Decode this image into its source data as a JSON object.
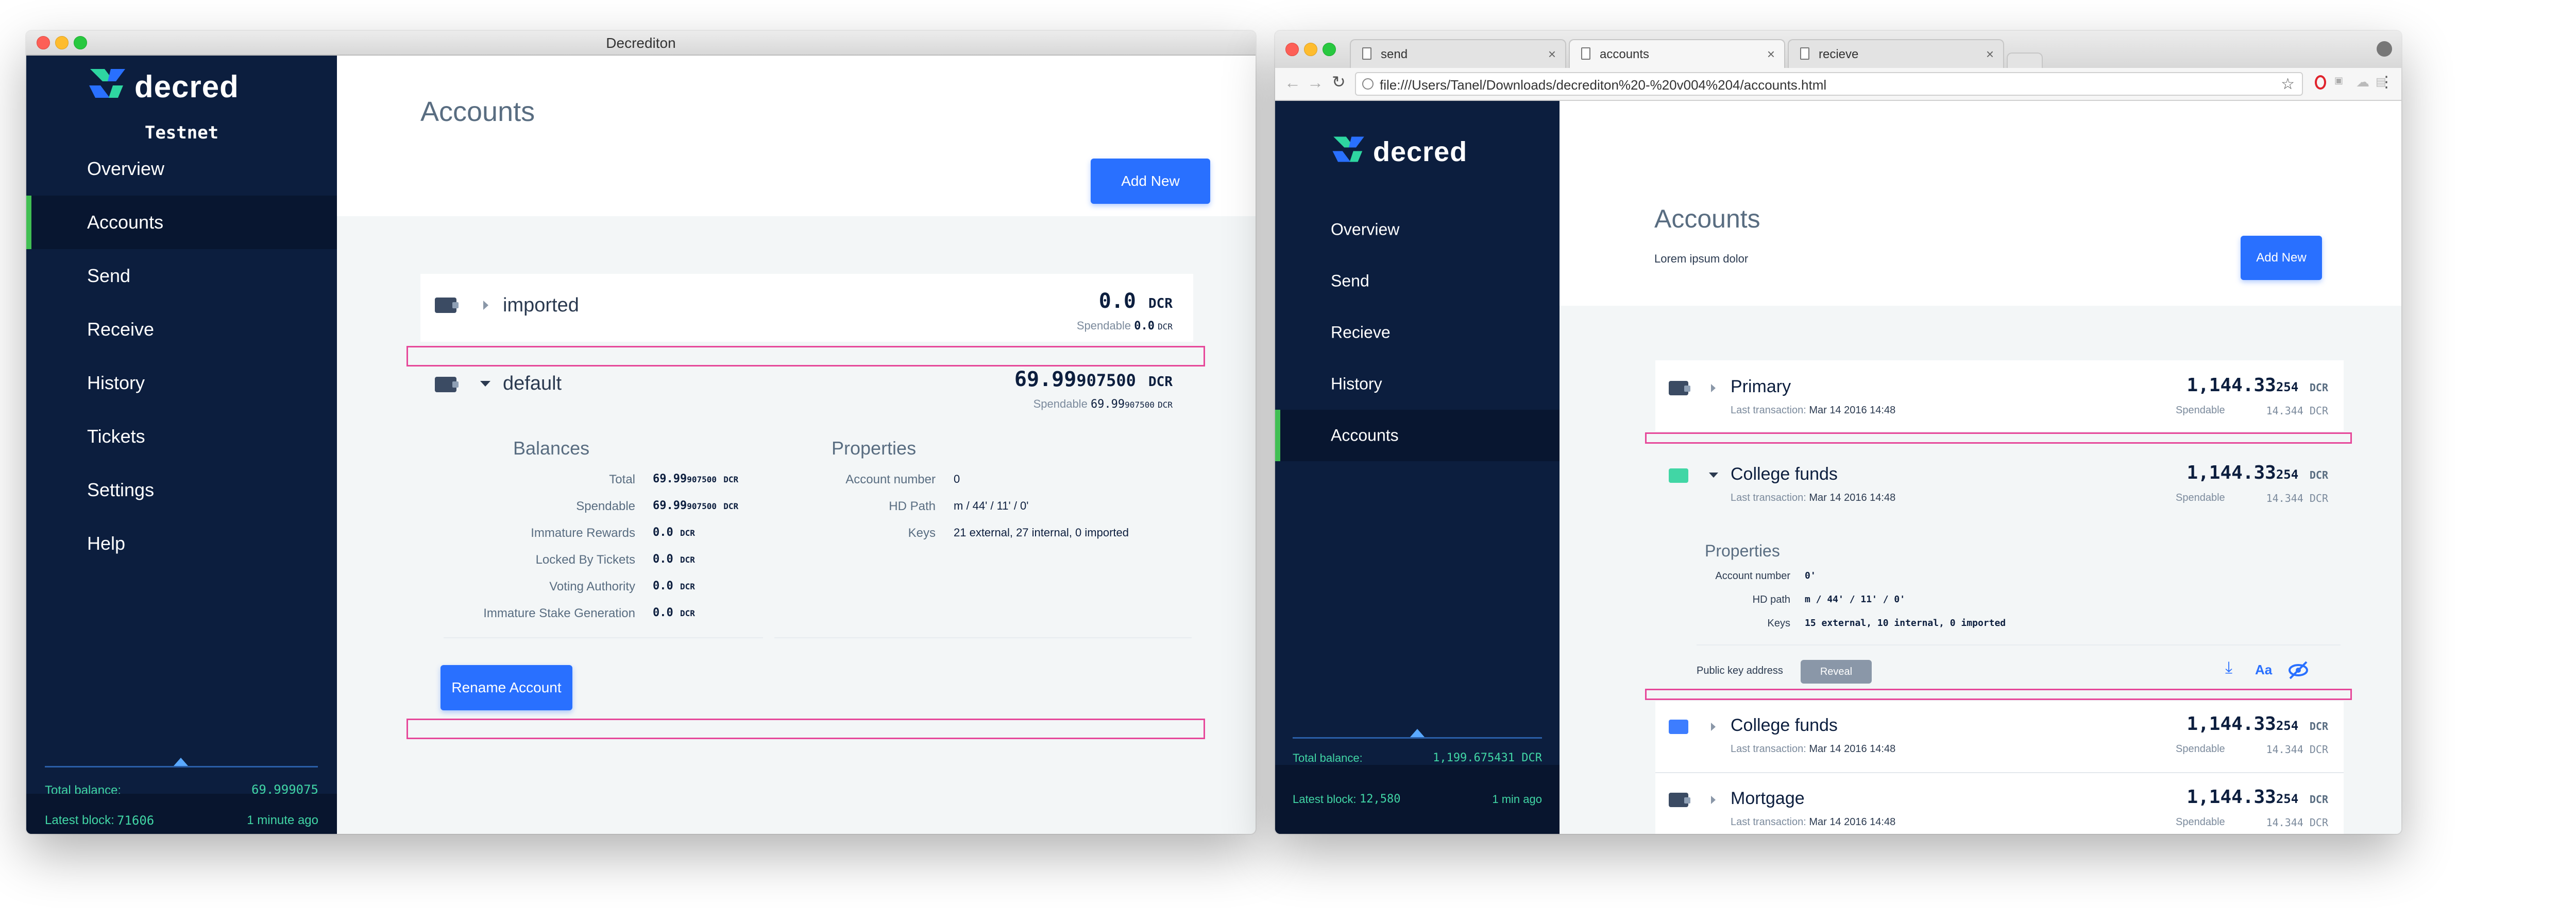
{
  "left_window": {
    "title": "Decrediton",
    "logo_text": "decred",
    "network": "Testnet",
    "nav": [
      {
        "label": "Overview",
        "active": false
      },
      {
        "label": "Accounts",
        "active": true
      },
      {
        "label": "Send",
        "active": false
      },
      {
        "label": "Receive",
        "active": false
      },
      {
        "label": "History",
        "active": false
      },
      {
        "label": "Tickets",
        "active": false
      },
      {
        "label": "Settings",
        "active": false
      },
      {
        "label": "Help",
        "active": false
      }
    ],
    "total_balance_label": "Total balance:",
    "total_balance_value": "69.999075",
    "latest_block_label": "Latest block:",
    "latest_block_value": "71606",
    "latest_block_time": "1 minute ago",
    "page_title": "Accounts",
    "add_new": "Add New",
    "accounts": [
      {
        "name": "imported",
        "balance_main": "0.0",
        "balance_unit": "DCR",
        "spendable_label": "Spendable",
        "spendable_value": "0.0",
        "spendable_unit": "DCR"
      },
      {
        "name": "default",
        "balance_main": "69.99",
        "balance_fine": "907500",
        "balance_unit": "DCR",
        "spendable_label": "Spendable",
        "spendable_main": "69.99",
        "spendable_fine": "907500",
        "spendable_unit": "DCR"
      }
    ],
    "balances_title": "Balances",
    "balances": [
      {
        "label": "Total",
        "value": "69.99",
        "fine": "907500",
        "unit": "DCR"
      },
      {
        "label": "Spendable",
        "value": "69.99",
        "fine": "907500",
        "unit": "DCR"
      },
      {
        "label": "Immature Rewards",
        "value": "0.0",
        "unit": "DCR"
      },
      {
        "label": "Locked By Tickets",
        "value": "0.0",
        "unit": "DCR"
      },
      {
        "label": "Voting Authority",
        "value": "0.0",
        "unit": "DCR"
      },
      {
        "label": "Immature Stake Generation",
        "value": "0.0",
        "unit": "DCR"
      }
    ],
    "properties_title": "Properties",
    "properties": [
      {
        "label": "Account number",
        "value": "0"
      },
      {
        "label": "HD Path",
        "value": "m / 44' / 11' / 0'"
      },
      {
        "label": "Keys",
        "value": "21 external, 27 internal, 0 imported"
      }
    ],
    "rename_button": "Rename Account"
  },
  "right_window": {
    "tabs": [
      {
        "label": "send",
        "active": false
      },
      {
        "label": "accounts",
        "active": true
      },
      {
        "label": "recieve",
        "active": false
      }
    ],
    "url": "file:///Users/Tanel/Downloads/decrediton%20-%20v004%204/accounts.html",
    "logo_text": "decred",
    "nav": [
      {
        "label": "Overview",
        "active": false
      },
      {
        "label": "Send",
        "active": false
      },
      {
        "label": "Recieve",
        "active": false
      },
      {
        "label": "History",
        "active": false
      },
      {
        "label": "Accounts",
        "active": true
      }
    ],
    "total_balance_label": "Total balance:",
    "total_balance_value": "1,199.675431 DCR",
    "latest_block_label": "Latest block:",
    "latest_block_value": "12,580",
    "latest_block_time": "1 min ago",
    "page_title": "Accounts",
    "page_subtitle": "Lorem ipsum dolor",
    "add_new": "Add New",
    "accounts": [
      {
        "name": "Primary",
        "balance_main": "1,144.33",
        "balance_fine": "254",
        "balance_unit": "DCR",
        "last_tx_label": "Last transaction:",
        "last_tx": "Mar 14 2016 14:48",
        "spendable_label": "Spendable",
        "spendable_value": "14.344",
        "spendable_unit": "DCR",
        "icon_color": "#3b4b63"
      },
      {
        "name": "College funds",
        "balance_main": "1,144.33",
        "balance_fine": "254",
        "balance_unit": "DCR",
        "last_tx_label": "Last transaction:",
        "last_tx": "Mar 14 2016 14:48",
        "spendable_label": "Spendable",
        "spendable_value": "14.344",
        "spendable_unit": "DCR",
        "icon_color": "#41d6a5"
      },
      {
        "name": "College funds",
        "balance_main": "1,144.33",
        "balance_fine": "254",
        "balance_unit": "DCR",
        "last_tx_label": "Last transaction:",
        "last_tx": "Mar 14 2016 14:48",
        "spendable_label": "Spendable",
        "spendable_value": "14.344",
        "spendable_unit": "DCR",
        "icon_color": "#3d7dff"
      },
      {
        "name": "Mortgage",
        "balance_main": "1,144.33",
        "balance_fine": "254",
        "balance_unit": "DCR",
        "last_tx_label": "Last transaction:",
        "last_tx": "Mar 14 2016 14:48",
        "spendable_label": "Spendable",
        "spendable_value": "14.344",
        "spendable_unit": "DCR",
        "icon_color": "#3b4b63"
      }
    ],
    "properties_title": "Properties",
    "properties": [
      {
        "label": "Account number",
        "value": "0'"
      },
      {
        "label": "HD path",
        "value": "m / 44' / 11' / 0'"
      },
      {
        "label": "Keys",
        "value": "15 external, 10 internal, 0 imported"
      }
    ],
    "public_key_label": "Public key address",
    "reveal_button": "Reveal",
    "aa_icon_text": "Aa"
  }
}
